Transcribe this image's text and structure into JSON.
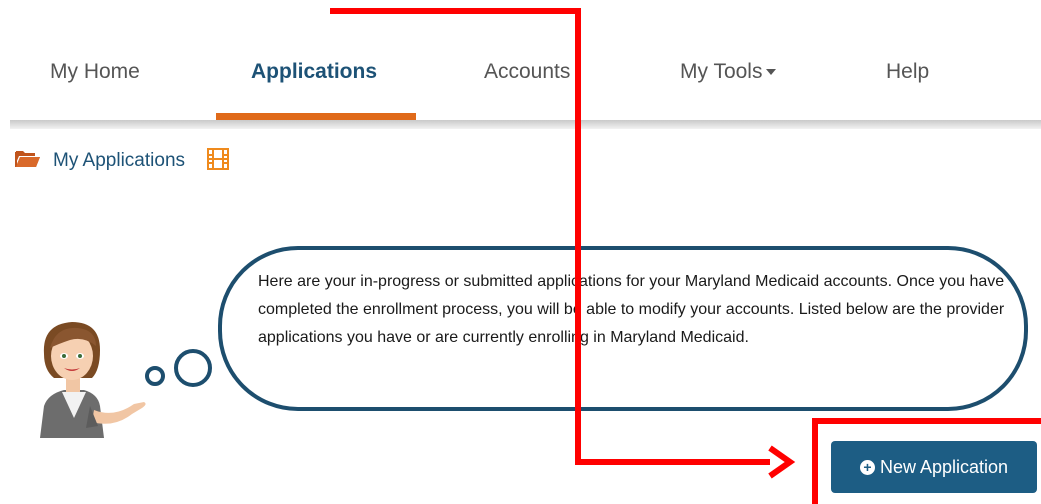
{
  "nav": {
    "items": [
      {
        "label": "My Home",
        "active": false
      },
      {
        "label": "Applications",
        "active": true
      },
      {
        "label": "Accounts",
        "active": false
      },
      {
        "label": "My Tools",
        "active": false,
        "has_dropdown": true
      },
      {
        "label": "Help",
        "active": false
      }
    ],
    "active_underline_color": "#e06a1a"
  },
  "breadcrumb": {
    "label": "My Applications",
    "icons": [
      "folder-open-icon",
      "film-icon"
    ]
  },
  "bubble": {
    "text": "Here are your in-progress or submitted applications for your Maryland Medicaid accounts. Once you have completed the enrollment process, you will be able to modify your accounts. Listed below are the provider applications you have or are currently enrolling in Maryland Medicaid."
  },
  "new_application_button": {
    "label": "New Application",
    "icon": "plus-circle-icon"
  },
  "colors": {
    "brand_blue": "#1d5276",
    "button_blue": "#1d5d84",
    "accent_orange": "#e06a1a",
    "annotation_red": "#ff0000"
  }
}
